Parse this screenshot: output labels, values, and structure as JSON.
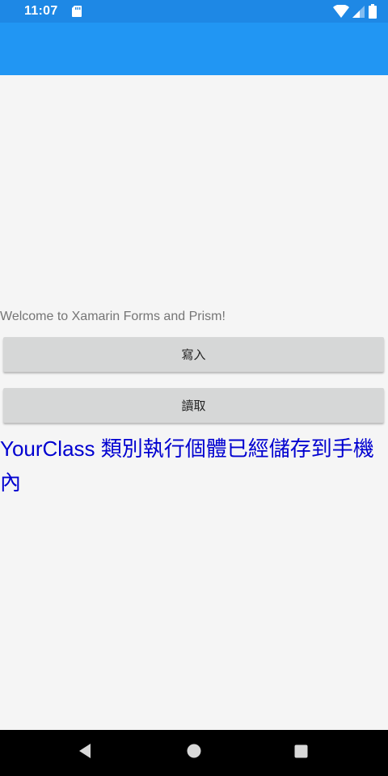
{
  "status_bar": {
    "time": "11:07",
    "icons": [
      "sd-card-icon",
      "wifi-icon",
      "signal-icon",
      "battery-icon"
    ],
    "color": "#1e88e5"
  },
  "toolbar": {
    "color": "#2196f3"
  },
  "main": {
    "welcome_text": "Welcome to Xamarin Forms and Prism!",
    "write_button_label": "寫入",
    "read_button_label": "讀取",
    "message": "YourClass 類別執行個體已經儲存到手機內",
    "message_color": "#0000d0"
  },
  "nav_bar": {
    "buttons": [
      "back-icon",
      "home-icon",
      "recents-icon"
    ]
  }
}
